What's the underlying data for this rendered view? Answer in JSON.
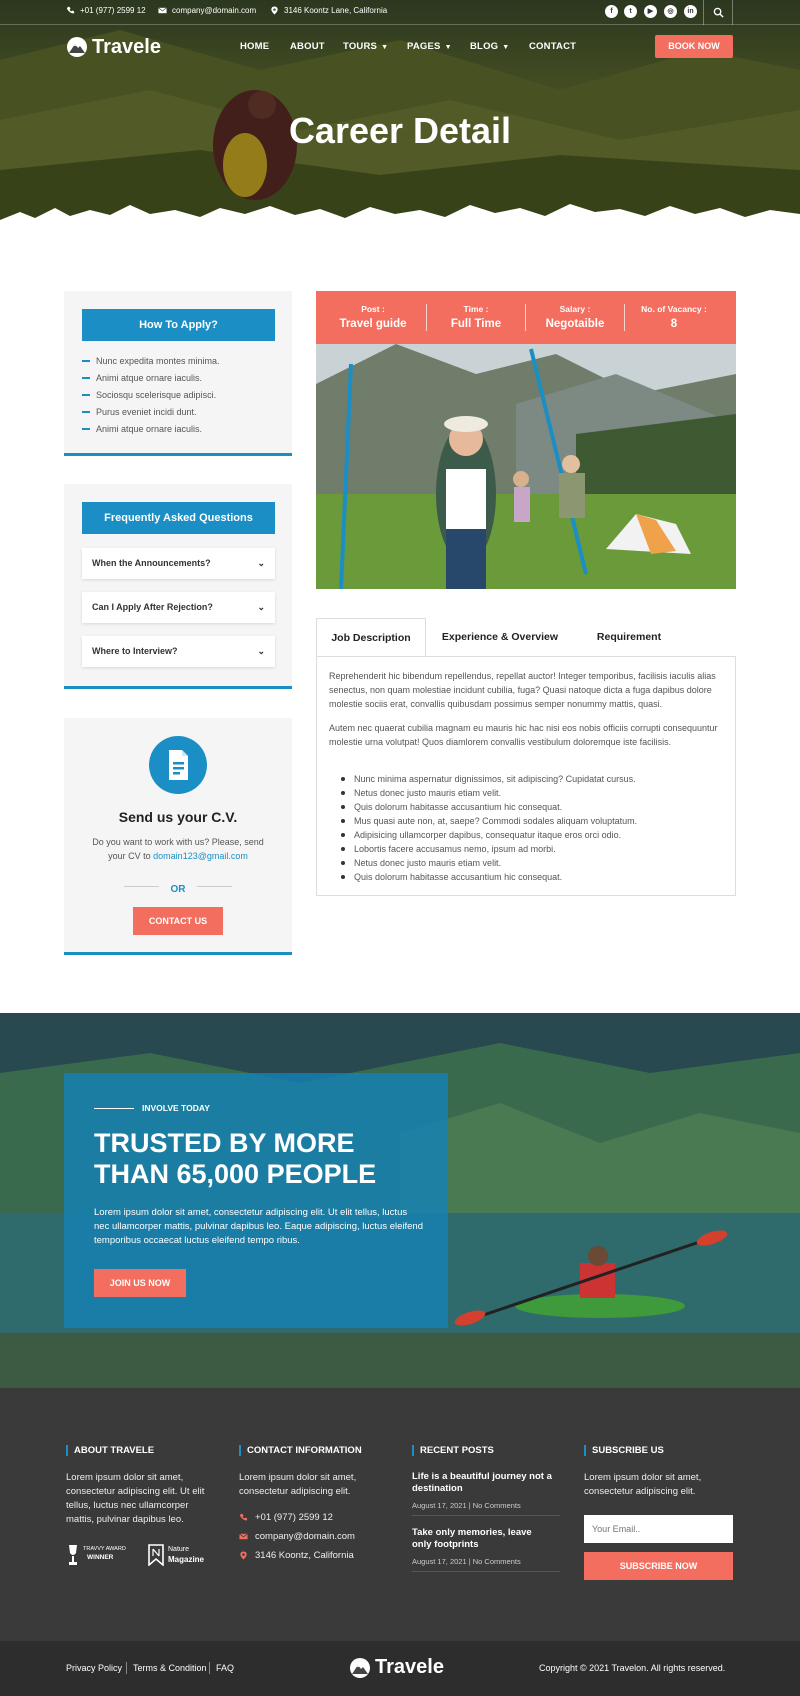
{
  "topbar": {
    "phone": "+01 (977) 2599 12",
    "email": "company@domain.com",
    "address": "3146 Koontz Lane, California",
    "social_icons": [
      "facebook-icon",
      "twitter-icon",
      "youtube-icon",
      "instagram-icon",
      "linkedin-icon"
    ],
    "social_glyphs": [
      "f",
      "t",
      "▶",
      "◎",
      "in"
    ]
  },
  "header": {
    "logo_text": "Travele",
    "nav": [
      {
        "label": "HOME"
      },
      {
        "label": "ABOUT"
      },
      {
        "label": "TOURS"
      },
      {
        "label": "PAGES"
      },
      {
        "label": "BLOG"
      },
      {
        "label": "CONTACT"
      }
    ],
    "book_now_label": "BOOK NOW"
  },
  "hero": {
    "title": "Career Detail"
  },
  "sidebar": {
    "apply": {
      "heading": "How To Apply?",
      "items": [
        "Nunc expedita montes minima.",
        "Animi atque ornare iaculis.",
        "Sociosqu scelerisque adipisci.",
        "Purus eveniet incidi dunt.",
        "Animi atque ornare iaculis."
      ]
    },
    "faq": {
      "heading": "Frequently Asked Questions",
      "items": [
        "When the Announcements?",
        "Can I Apply After Rejection?",
        "Where to Interview?"
      ]
    },
    "cv": {
      "title": "Send us your C.V.",
      "text": "Do you want to work with us? Please, send your CV to",
      "email": "domain123@gmail.com",
      "or": "OR",
      "button": "CONTACT US"
    }
  },
  "job": {
    "stats": [
      {
        "label": "Post :",
        "value": "Travel guide"
      },
      {
        "label": "Time :",
        "value": "Full Time"
      },
      {
        "label": "Salary :",
        "value": "Negotaible"
      },
      {
        "label": "No. of Vacancy :",
        "value": "8"
      }
    ],
    "tabs": [
      "Job Description",
      "Experience & Overview",
      "Requirement"
    ],
    "paragraphs": [
      "Reprehenderit hic bibendum repellendus, repellat auctor! Integer temporibus, facilisis iaculis alias senectus, non quam molestiae incidunt cubilia, fuga? Quasi natoque dicta a fuga dapibus dolore molestie sociis erat, convallis quibusdam possimus semper nonummy mattis, quasi.",
      "Autem nec quaerat cubilia magnam eu mauris hic hac nisi eos nobis officiis corrupti consequuntur molestie urna volutpat! Quos diamlorem convallis vestibulum doloremque iste facilisis."
    ],
    "bullets": [
      "Nunc minima aspernatur dignissimos, sit adipiscing? Cupidatat cursus.",
      "Netus donec justo mauris etiam velit.",
      "Quis dolorum habitasse accusantium hic consequat.",
      "Mus quasi aute non, at, saepe? Commodi sodales aliquam voluptatum.",
      "Adipisicing ullamcorper dapibus, consequatur itaque eros orci odio.",
      "Lobortis facere accusamus nemo, ipsum ad morbi.",
      "Netus donec justo mauris etiam velit.",
      "Quis dolorum habitasse accusantium hic consequat."
    ]
  },
  "cta": {
    "kicker": "INVOLVE TODAY",
    "title_line1": "TRUSTED BY MORE",
    "title_line2": "THAN 65,000 PEOPLE",
    "text": "Lorem ipsum dolor sit amet, consectetur adipiscing elit. Ut elit tellus, luctus nec ullamcorper mattis, pulvinar dapibus leo. Eaque adipiscing, luctus eleifend temporibus occaecat luctus eleifend tempo ribus.",
    "button": "JOIN US NOW"
  },
  "footer": {
    "about": {
      "heading": "ABOUT TRAVELE",
      "text": "Lorem ipsum dolor sit amet, consectetur adipiscing elit. Ut elit tellus, luctus nec ullamcorper mattis, pulvinar dapibus leo.",
      "award1_line1": "TRAVVY AWARD",
      "award1_line2": "WINNER",
      "award2_line1": "Nature",
      "award2_line2": "Magazine"
    },
    "contact": {
      "heading": "CONTACT INFORMATION",
      "text": "Lorem ipsum dolor sit amet, consectetur adipiscing elit.",
      "phone": "+01 (977) 2599 12",
      "email": "company@domain.com",
      "address": "3146 Koontz, California"
    },
    "recent": {
      "heading": "RECENT POSTS",
      "posts": [
        {
          "title": "Life is a beautiful journey not a destination",
          "date": "August 17, 2021",
          "comments": "No Comments"
        },
        {
          "title": "Take only memories, leave only footprints",
          "date": "August 17, 2021",
          "comments": "No Comments"
        }
      ]
    },
    "subscribe": {
      "heading": "SUBSCRIBE US",
      "text": "Lorem ipsum dolor sit amet, consectetur adipiscing elit.",
      "placeholder": "Your Email..",
      "button": "SUBSCRIBE NOW"
    }
  },
  "bottom": {
    "links": [
      "Privacy Policy",
      "Terms & Condition",
      "FAQ"
    ],
    "logo_text": "Travele",
    "copyright": "Copyright © 2021 Travelon. All rights reserved."
  },
  "colors": {
    "accent": "#f36e5f",
    "primary": "#1b8fc5",
    "footer": "#3a3a3a"
  }
}
